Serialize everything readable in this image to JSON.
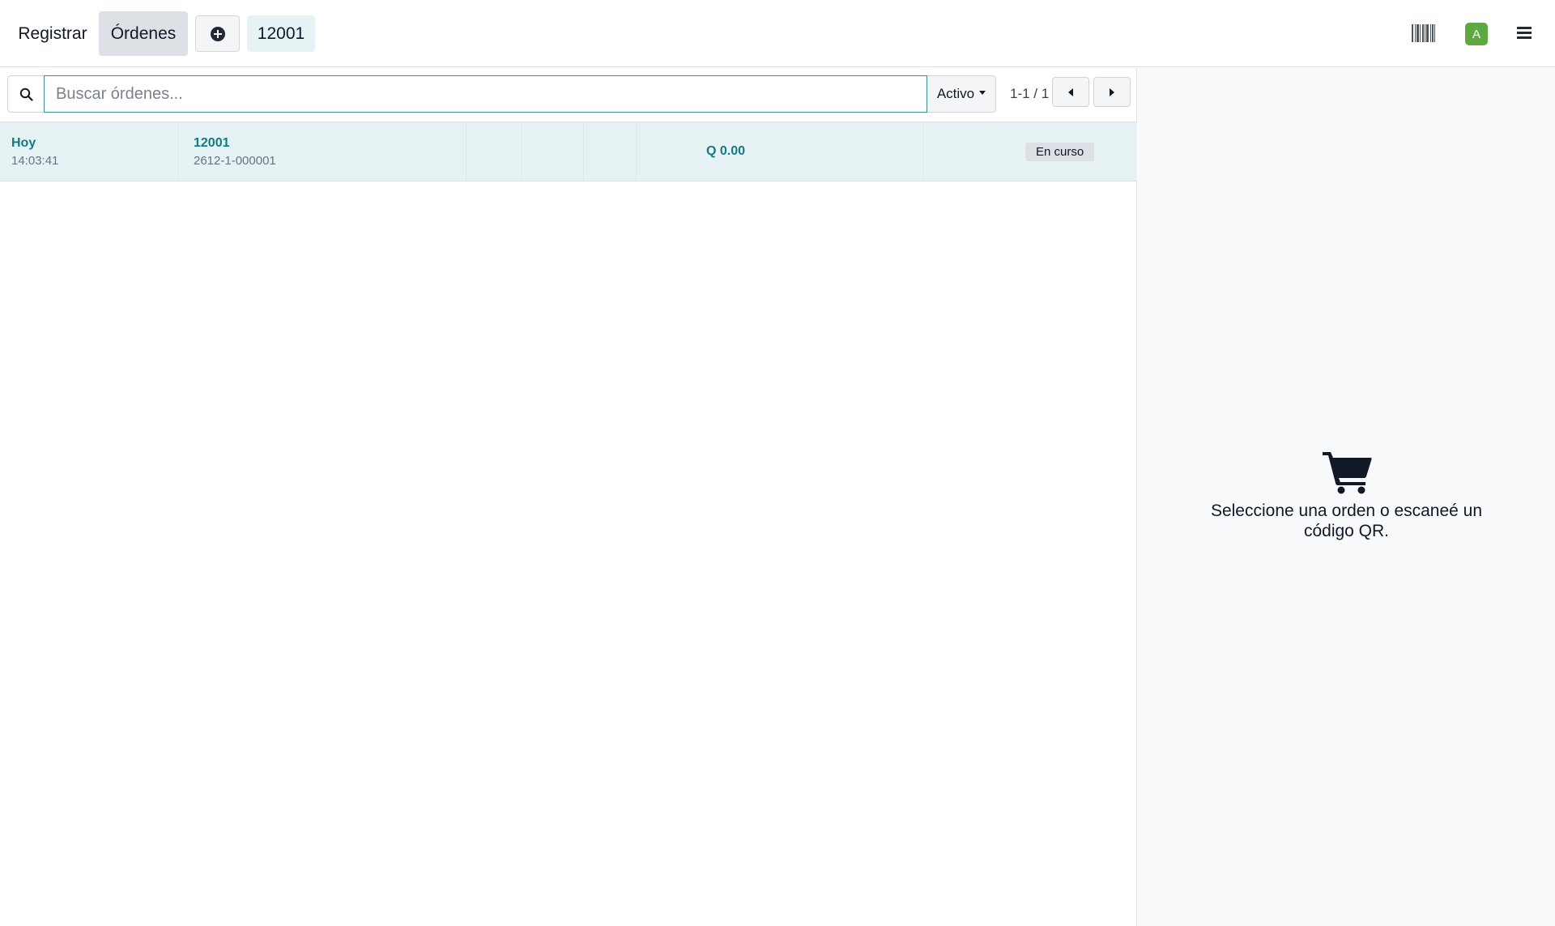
{
  "topbar": {
    "register_label": "Registrar",
    "orders_label": "Órdenes",
    "new_order_icon": "plus-circle-icon",
    "current_order_tab": "12001",
    "barcode_icon": "barcode-icon",
    "avatar_letter": "A",
    "avatar_color": "#5fa943",
    "menu_icon": "hamburger-icon"
  },
  "search": {
    "placeholder": "Buscar órdenes...",
    "value": "",
    "filter_label": "Activo",
    "pager": "1-1 / 1"
  },
  "orders": [
    {
      "date": "Hoy",
      "time": "14:03:41",
      "name": "12001",
      "reference": "2612-1-000001",
      "total": "Q 0.00",
      "status": "En curso"
    }
  ],
  "empty_state": {
    "icon": "shopping-cart-icon",
    "message": "Seleccione una orden o escaneé un código QR."
  },
  "colors": {
    "accent": "#117a83",
    "row_selected": "#e6f2f3",
    "active_nav": "#dde0e4"
  }
}
